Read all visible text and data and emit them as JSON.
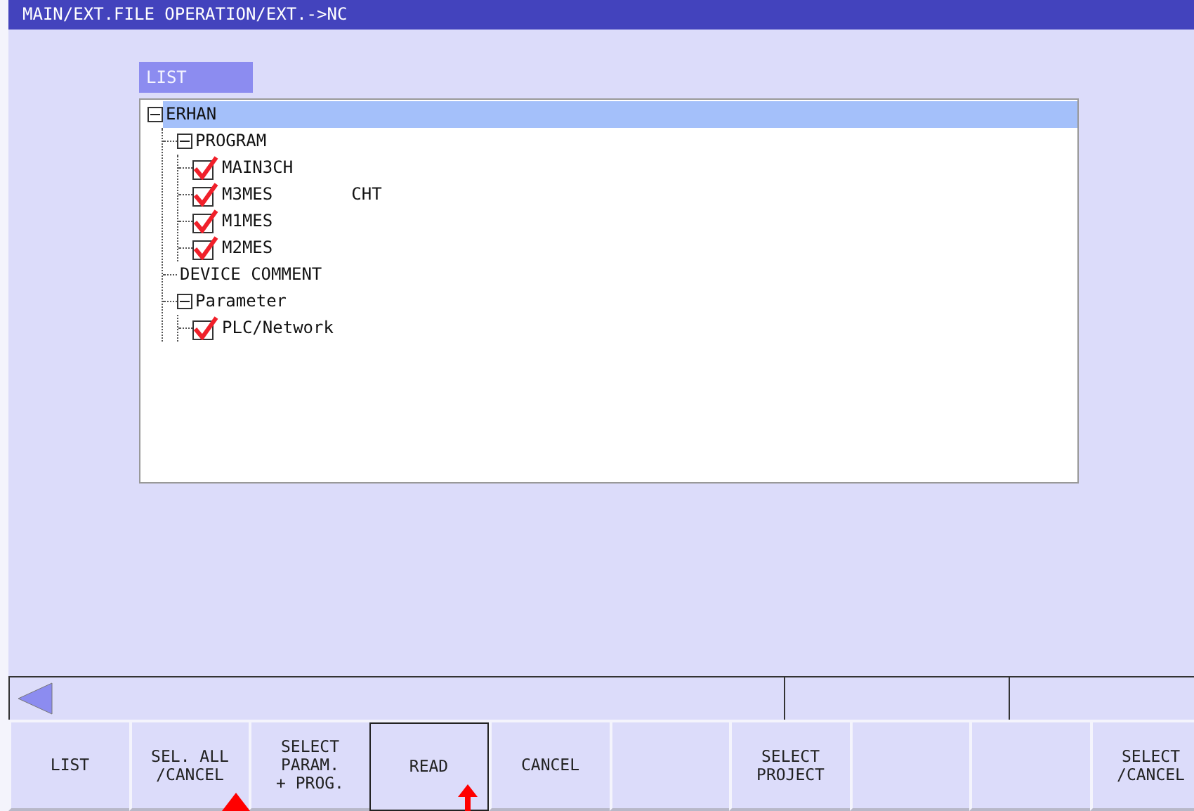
{
  "window": {
    "title": "MAIN/EXT.FILE OPERATION/EXT.->NC"
  },
  "list_tab": {
    "label": "LIST"
  },
  "tree": [
    {
      "label": "ERHAN",
      "expanded": true,
      "selected": true,
      "children": [
        {
          "label": "PROGRAM",
          "expanded": true,
          "selected": false,
          "children": [
            {
              "label": "MAIN3CH",
              "checked": true,
              "selected": false
            },
            {
              "label": "M3MES",
              "checked": true,
              "selected": false,
              "note": "CHT"
            },
            {
              "label": "M1MES",
              "checked": true,
              "selected": false
            },
            {
              "label": "M2MES",
              "checked": true,
              "selected": false
            }
          ]
        },
        {
          "label": "DEVICE COMMENT",
          "selected": false
        },
        {
          "label": "Parameter",
          "expanded": true,
          "selected": false,
          "children": [
            {
              "label": "PLC/Network",
              "checked": true,
              "selected": false
            }
          ]
        }
      ]
    }
  ],
  "softkeys": [
    {
      "lines": [
        "LIST"
      ],
      "selected": false
    },
    {
      "lines": [
        "SEL. ALL",
        "/CANCEL"
      ],
      "selected": false
    },
    {
      "lines": [
        "SELECT",
        "PARAM.",
        "+ PROG."
      ],
      "selected": false
    },
    {
      "lines": [
        "READ"
      ],
      "selected": true
    },
    {
      "lines": [
        "CANCEL"
      ],
      "selected": false
    },
    {
      "selected": false
    },
    {
      "lines": [
        "SELECT",
        "PROJECT"
      ],
      "selected": false
    },
    {
      "selected": false
    },
    {
      "selected": false
    },
    {
      "lines": [
        "SELECT",
        "/CANCEL"
      ],
      "selected": false
    }
  ]
}
